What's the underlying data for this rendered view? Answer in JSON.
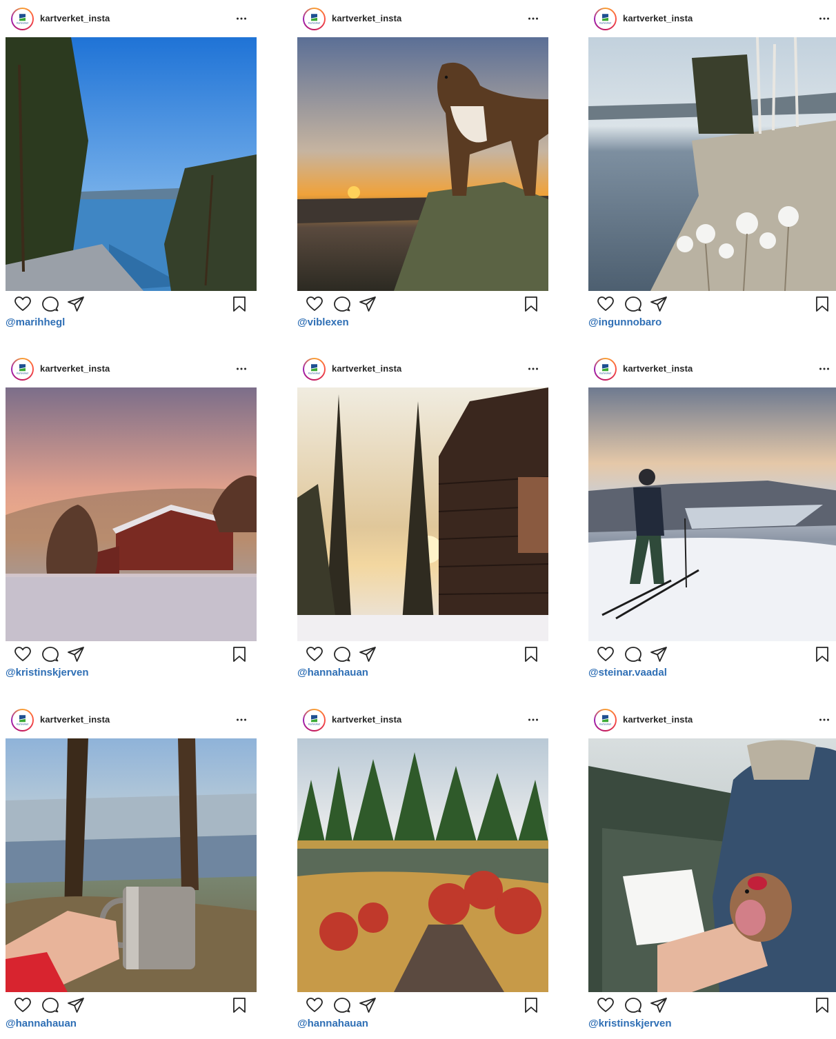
{
  "posts": [
    {
      "username": "kartverket_insta",
      "credit": "@marihhegl",
      "scene": "fjord-pines"
    },
    {
      "username": "kartverket_insta",
      "credit": "@viblexen",
      "scene": "dog-sunset"
    },
    {
      "username": "kartverket_insta",
      "credit": "@ingunnobaro",
      "scene": "frosty-lake"
    },
    {
      "username": "kartverket_insta",
      "credit": "@kristinskjerven",
      "scene": "red-barn"
    },
    {
      "username": "kartverket_insta",
      "credit": "@hannahauan",
      "scene": "log-cabin-winter"
    },
    {
      "username": "kartverket_insta",
      "credit": "@steinar.vaadal",
      "scene": "skier-summit"
    },
    {
      "username": "kartverket_insta",
      "credit": "@hannahauan",
      "scene": "mug-viewpoint"
    },
    {
      "username": "kartverket_insta",
      "credit": "@hannahauan",
      "scene": "autumn-pond"
    },
    {
      "username": "kartverket_insta",
      "credit": "@kristinskjerven",
      "scene": "bird-ringing"
    }
  ],
  "logo": {
    "text": "Kartverket",
    "colors": {
      "blue": "#1d4f91",
      "green": "#3aa935",
      "ring": "#e1306c"
    }
  },
  "colors": {
    "link": "#2f6fb5",
    "text": "#262626",
    "icon": "#262626"
  },
  "icons": [
    "heart-icon",
    "comment-icon",
    "share-icon",
    "bookmark-icon",
    "more-icon"
  ]
}
